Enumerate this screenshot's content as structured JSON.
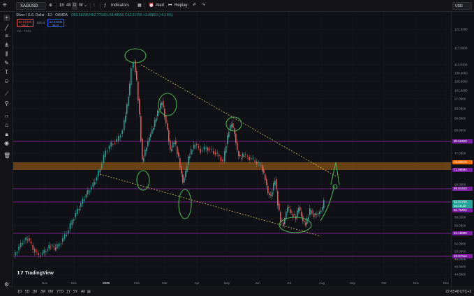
{
  "toolbar": {
    "symbol": "XAGUSD",
    "timeframes": [
      "1h",
      "4h",
      "D",
      "W"
    ],
    "active_timeframe": "D",
    "indicators_label": "Indicators",
    "alert_label": "Alert",
    "replay_label": "Replay",
    "currency": "USD"
  },
  "legend": {
    "title": "Silver / U.S. Dollar · 1D · OANDA",
    "ohlc": "O59.55295  H62.77930  L58.48550  C62.01750  +3.49810 (+6.18%)"
  },
  "trade": {
    "sell_price": "62.01006",
    "sell_label": "SELL",
    "spread": "620.0",
    "buy_price": "62.04236",
    "buy_label": "BUY",
    "volume_label": "Vol · Ticks"
  },
  "price_axis": {
    "labels": [
      "122.0000",
      "117.0000",
      "113.0000",
      "109.0000",
      "105.0000",
      "101.0000",
      "97.0000",
      "93.0000",
      "89.0000",
      "85.0000",
      "81.0000",
      "77.0000",
      "69.0000",
      "58.0000",
      "56.0000",
      "52.0000",
      "50.0000",
      "48.0000",
      "46.0000",
      "44.0000"
    ],
    "badges": [
      {
        "text": "80.53400",
        "color": "#7b1fa2"
      },
      {
        "text": "73.90578",
        "color": "#ef6c00"
      },
      {
        "text": "71.58584",
        "color": "#7b1fa2"
      },
      {
        "text": "65.61443",
        "color": "#7b1fa2"
      },
      {
        "text": "62.01750",
        "color": "#26a69a"
      },
      {
        "text": "01:16:12",
        "color": "#26a69a"
      },
      {
        "text": "61.76404",
        "color": "#7b1fa2"
      },
      {
        "text": "54.18899",
        "color": "#7b1fa2"
      },
      {
        "text": "48.97613",
        "color": "#7b1fa2"
      }
    ]
  },
  "time_axis": {
    "labels": [
      "Nov",
      "Dec",
      "2026",
      "Feb",
      "Mar",
      "Apr",
      "May",
      "Jun",
      "Jul",
      "Aug",
      "Sep",
      "Oct",
      "Nov",
      "Dec"
    ]
  },
  "ranges": [
    "1D",
    "5D",
    "1M",
    "3M",
    "6M",
    "YTD",
    "1Y",
    "5Y",
    "All"
  ],
  "clock": "22:43:48 UTC+3",
  "branding": "TradingView",
  "colors": {
    "up": "#26a69a",
    "down": "#ef5350",
    "purple_line": "#9c27b0",
    "orange_zone": "#b26a1d",
    "drawing": "#4caf50"
  }
}
